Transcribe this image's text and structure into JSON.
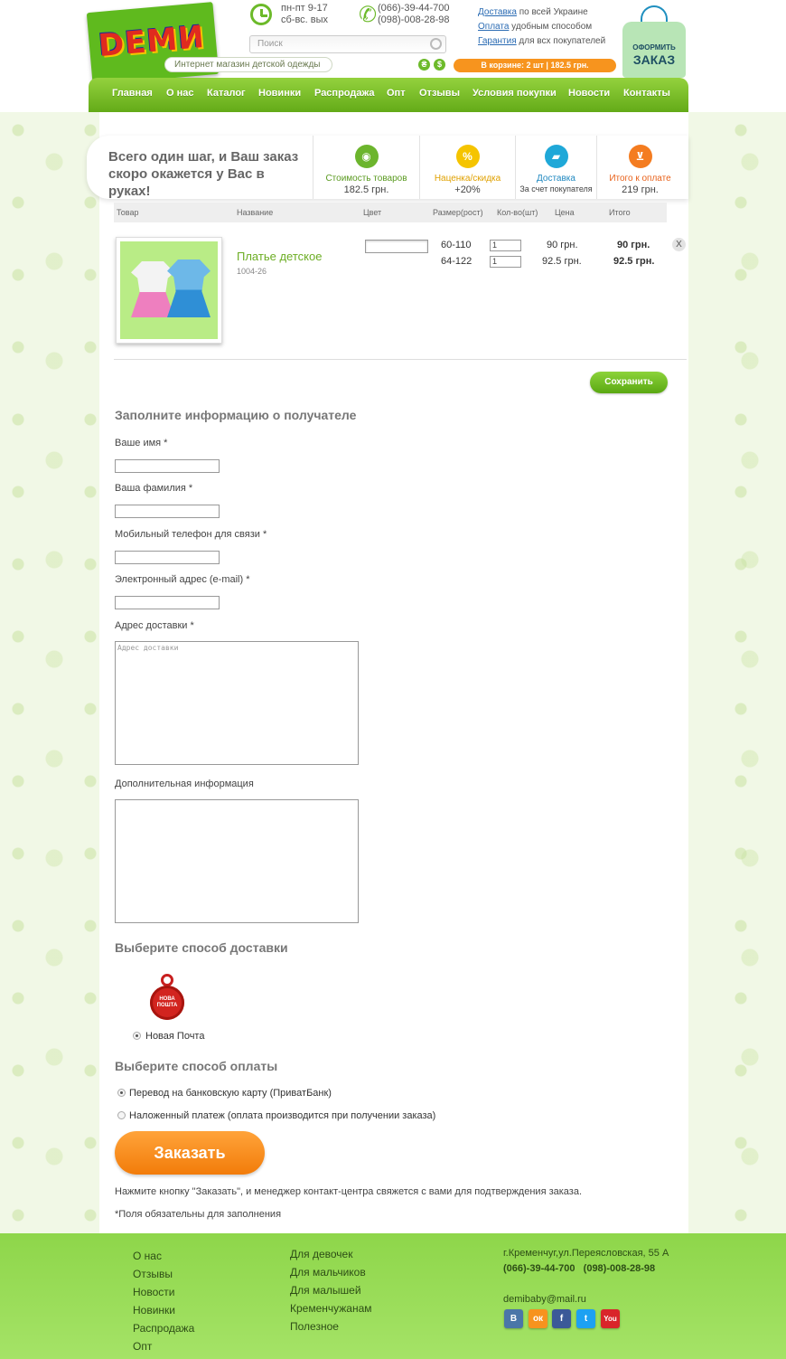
{
  "header": {
    "logo": "DEMИ",
    "slogan": "Интернет магазин детской одежды",
    "hours": [
      "пн-пт 9-17",
      "сб-вс. вых"
    ],
    "phones": [
      "(066)-39-44-700",
      "(098)-008-28-98"
    ],
    "search_placeholder": "Поиск",
    "info": [
      {
        "link": "Доставка",
        "text": " по всей Украине"
      },
      {
        "link": "Оплата",
        "text": " удобным способом"
      },
      {
        "link": "Гарантия",
        "text": " для всх покупателей"
      }
    ],
    "currency": [
      "₴",
      "$"
    ],
    "cart": "В корзине: 2 шт | 182.5 грн.",
    "order_badge": [
      "ОФОРМИТЬ",
      "ЗАКАЗ"
    ]
  },
  "nav": [
    "Главная",
    "О нас",
    "Каталог",
    "Новинки",
    "Распродажа",
    "Опт",
    "Отзывы",
    "Условия покупки",
    "Новости",
    "Контакты"
  ],
  "steps": {
    "title": "Всего один шаг, и Ваш заказ скоро окажется у Вас в руках!",
    "items": [
      {
        "label": "Стоимость товаров",
        "value": "182.5 грн.",
        "color": "#6cb52d"
      },
      {
        "label": "Наценка/скидка",
        "value": "+20%",
        "color": "#f5c400"
      },
      {
        "label": "Доставка",
        "value": "За счет покупателя",
        "color": "#1fa8d8"
      },
      {
        "label": "Итого к оплате",
        "value": "219 грн.",
        "color": "#f47c20"
      }
    ]
  },
  "table": {
    "headers": [
      "Товар",
      "Название",
      "Цвет",
      "Размер(рост)",
      "Кол-во(шт)",
      "Цена",
      "Итого"
    ],
    "product": {
      "name": "Платье детское",
      "sku": "1004-26",
      "rows": [
        {
          "size": "60-110",
          "qty": "1",
          "price": "90 грн.",
          "total": "90 грн."
        },
        {
          "size": "64-122",
          "qty": "1",
          "price": "92.5 грн.",
          "total": "92.5 грн."
        }
      ],
      "remove": "X"
    },
    "save": "Сохранить"
  },
  "form": {
    "title": "Заполните информацию о получателе",
    "fields": [
      "Ваше имя *",
      "Ваша фамилия *",
      "Мобильный телефон для связи *",
      "Электронный адрес (e-mail) *"
    ],
    "address_label": "Адрес доставки *",
    "address_placeholder": "Адрес доставки",
    "extra_label": "Дополнительная информация"
  },
  "delivery": {
    "title": "Выберите способ доставки",
    "logo_text": [
      "НОВА",
      "ПОШТА"
    ],
    "option": "Новая Почта"
  },
  "payment": {
    "title": "Выберите способ оплаты",
    "options": [
      "Перевод на банковскую карту (ПриватБанк)",
      "Наложенный платеж (оплата производится при получении заказа)"
    ]
  },
  "order_button": "Заказать",
  "notes": [
    "Нажмите кнопку \"Заказать\", и менеджер контакт-центра свяжется с вами для подтверждения заказа.",
    "*Поля обязательны для заполнения"
  ],
  "footer": {
    "col1": [
      "О нас",
      "Отзывы",
      "Новости",
      "Новинки",
      "Распродажа",
      "Опт"
    ],
    "col2": [
      "Для девочек",
      "Для мальчиков",
      "Для малышей",
      "Кременчужанам",
      "Полезное"
    ],
    "address": "г.Кременчуг,ул.Переясловская, 55 А",
    "phones": "(066)-39-44-700   (098)-008-28-98",
    "email": "demibaby@mail.ru",
    "social": [
      {
        "name": "vk-icon",
        "glyph": "В",
        "color": "#4a76a8"
      },
      {
        "name": "odnoklassniki-icon",
        "glyph": "ок",
        "color": "#f7931e"
      },
      {
        "name": "facebook-icon",
        "glyph": "f",
        "color": "#3b5998"
      },
      {
        "name": "twitter-icon",
        "glyph": "t",
        "color": "#1da1f2"
      },
      {
        "name": "youtube-icon",
        "glyph": "You",
        "color": "#d9252a"
      }
    ]
  }
}
